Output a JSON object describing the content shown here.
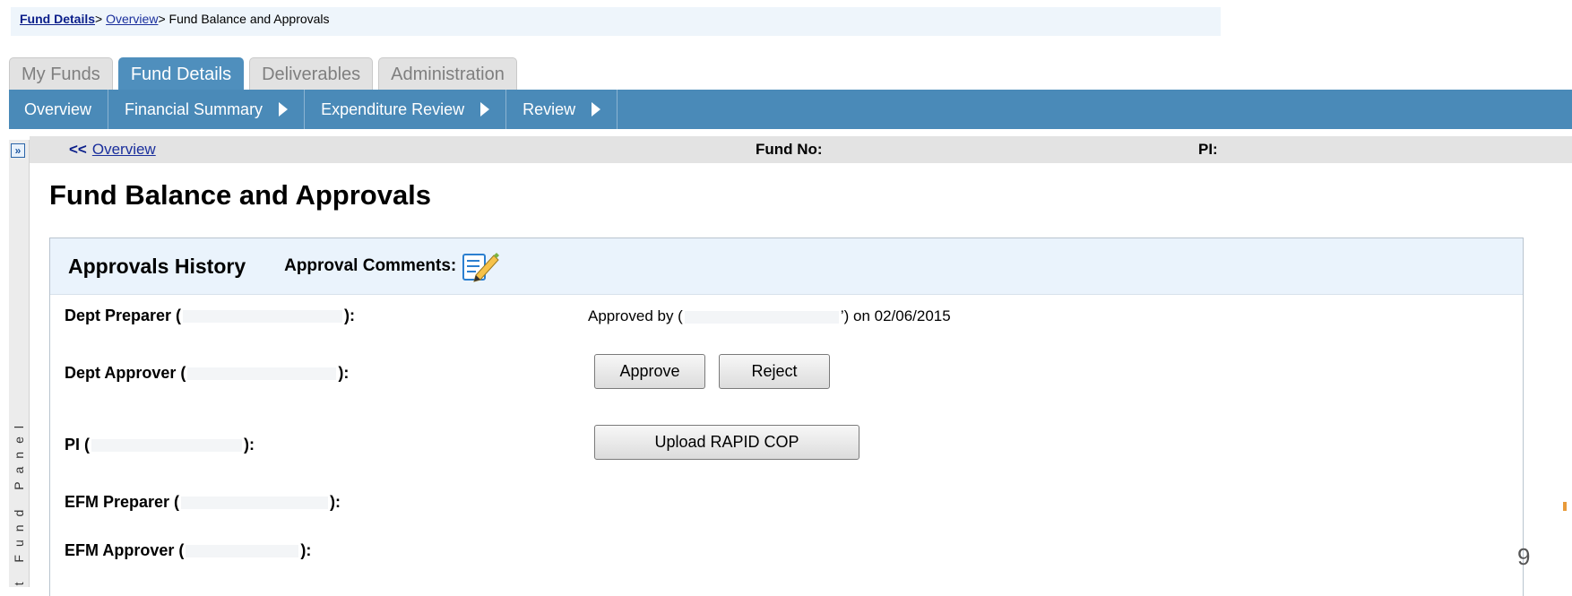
{
  "breadcrumb": {
    "items": [
      "Fund Details",
      "Overview"
    ],
    "separator": ">",
    "current": "Fund Balance and Approvals"
  },
  "tabs": [
    {
      "label": "My Funds",
      "active": false
    },
    {
      "label": "Fund Details",
      "active": true
    },
    {
      "label": "Deliverables",
      "active": false
    },
    {
      "label": "Administration",
      "active": false
    }
  ],
  "subnav": [
    {
      "label": "Overview",
      "has_arrow": false
    },
    {
      "label": "Financial Summary",
      "has_arrow": true
    },
    {
      "label": "Expenditure Review",
      "has_arrow": true
    },
    {
      "label": "Review",
      "has_arrow": true
    }
  ],
  "fund_panel": {
    "expand_icon": "double-chevron-right-icon",
    "label": "Fund Panel",
    "visible_label": "t Fund Panel"
  },
  "fund_header": {
    "back_arrows": "<<",
    "back_link": "Overview",
    "fund_no_label": "Fund No:",
    "pi_label": "PI:"
  },
  "page": {
    "title": "Fund Balance and Approvals"
  },
  "approvals": {
    "title": "Approvals History",
    "comments_label": "Approval Comments:",
    "comments_icon": "edit-note-icon",
    "rows": [
      {
        "role": "Dept Preparer (",
        "close": "):",
        "status": "Approved by (",
        "status_suffix": "’) on 02/06/2015"
      },
      {
        "role": "Dept Approver (",
        "close": "):",
        "actions": [
          "Approve",
          "Reject"
        ]
      },
      {
        "role": "PI (",
        "close": "):",
        "actions": [
          "Upload RAPID COP"
        ]
      },
      {
        "role": "EFM Preparer (",
        "close": "):"
      },
      {
        "role": "EFM Approver (",
        "close": "):"
      }
    ]
  },
  "footer": {
    "page_number": "9"
  },
  "colors": {
    "nav_blue": "#4a8ab8",
    "tab_active": "#4f8fbd",
    "link_blue": "#1a2f9c",
    "header_bg": "#eaf3fc"
  }
}
